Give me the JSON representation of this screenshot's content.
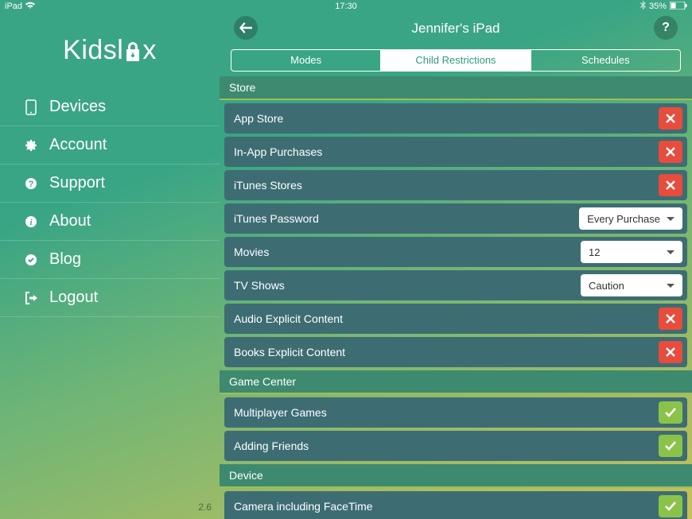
{
  "statusbar": {
    "device": "iPad",
    "time": "17:30",
    "battery": "35%"
  },
  "app": {
    "logo_pre": "Kidsl",
    "logo_post": "x",
    "version": "2.6"
  },
  "sidebar": {
    "items": [
      {
        "icon": "device-icon",
        "label": "Devices"
      },
      {
        "icon": "gear-icon",
        "label": "Account"
      },
      {
        "icon": "question-icon",
        "label": "Support"
      },
      {
        "icon": "info-icon",
        "label": "About"
      },
      {
        "icon": "check-circle-icon",
        "label": "Blog"
      },
      {
        "icon": "logout-icon",
        "label": "Logout"
      }
    ]
  },
  "header": {
    "title": "Jennifer's iPad",
    "help_glyph": "?"
  },
  "tabs": {
    "items": [
      "Modes",
      "Child Restrictions",
      "Schedules"
    ],
    "active_index": 1
  },
  "sections": [
    {
      "title": "Store",
      "rows": [
        {
          "label": "App Store",
          "control": "toggle",
          "value": false
        },
        {
          "label": "In-App Purchases",
          "control": "toggle",
          "value": false
        },
        {
          "label": "iTunes Stores",
          "control": "toggle",
          "value": false
        },
        {
          "label": "iTunes Password",
          "control": "select",
          "value": "Every Purchase"
        },
        {
          "label": "Movies",
          "control": "select",
          "value": "12"
        },
        {
          "label": "TV Shows",
          "control": "select",
          "value": "Caution"
        },
        {
          "label": "Audio Explicit Content",
          "control": "toggle",
          "value": false
        },
        {
          "label": "Books Explicit Content",
          "control": "toggle",
          "value": false
        }
      ]
    },
    {
      "title": "Game Center",
      "rows": [
        {
          "label": "Multiplayer Games",
          "control": "toggle",
          "value": true
        },
        {
          "label": "Adding Friends",
          "control": "toggle",
          "value": true
        }
      ]
    },
    {
      "title": "Device",
      "rows": [
        {
          "label": "Camera including FaceTime",
          "control": "toggle",
          "value": true
        }
      ]
    }
  ]
}
